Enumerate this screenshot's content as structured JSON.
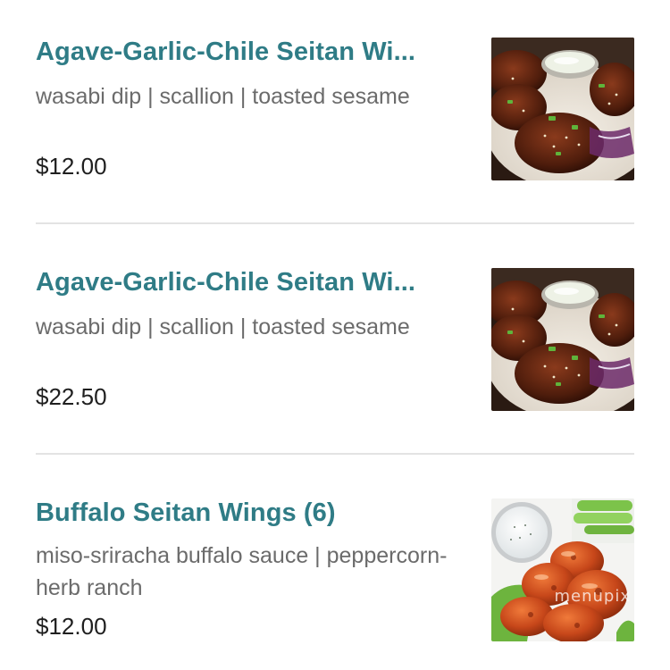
{
  "menu": {
    "items": [
      {
        "title": "Agave-Garlic-Chile Seitan Wi...",
        "description": "wasabi dip | scallion | toasted sesame",
        "price": "$12.00",
        "image_icon": "seitan-wings-photo"
      },
      {
        "title": "Agave-Garlic-Chile Seitan Wi...",
        "description": "wasabi dip | scallion | toasted sesame",
        "price": "$22.50",
        "image_icon": "seitan-wings-photo"
      },
      {
        "title": "Buffalo Seitan Wings (6)",
        "description": "miso-sriracha buffalo sauce | peppercorn-herb ranch",
        "price": "$12.00",
        "image_icon": "buffalo-wings-photo"
      }
    ],
    "watermark": "menupix"
  },
  "colors": {
    "title": "#2f7c86",
    "description": "#6b6b6b",
    "price": "#1f1f1f",
    "divider": "#e3e3e3"
  }
}
